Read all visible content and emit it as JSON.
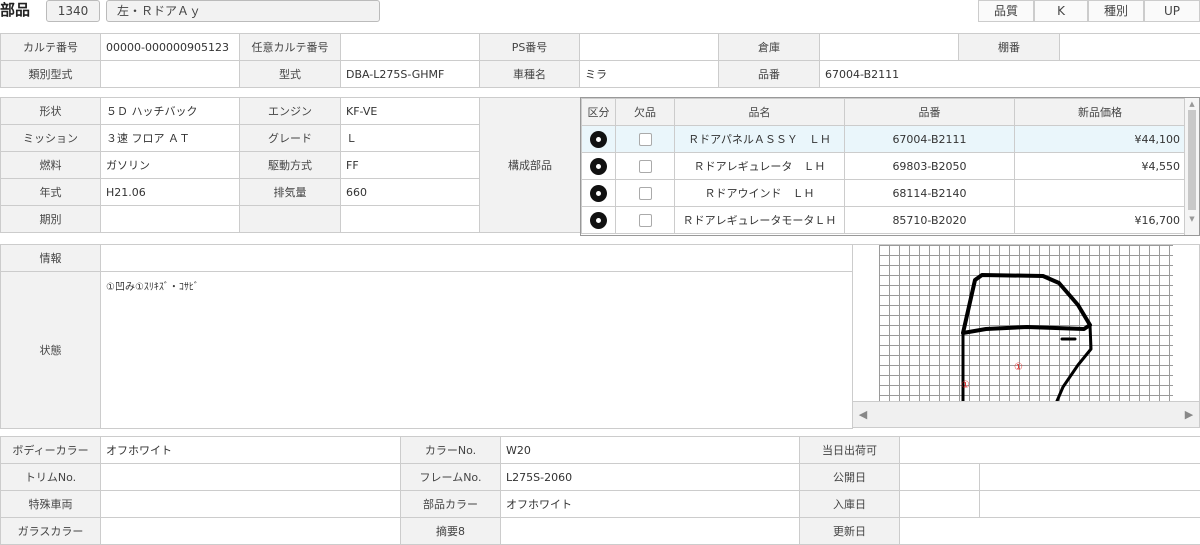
{
  "header": {
    "title": "部品",
    "code": "1340",
    "name": "左・ＲドアＡｙ",
    "quality_label": "品質",
    "quality_value": "K",
    "kind_label": "種別",
    "kind_value": "UP"
  },
  "info_rows": {
    "r1": {
      "karte_label": "カルテ番号",
      "karte_value": "00000-000000905123",
      "any_karte_label": "任意カルテ番号",
      "any_karte_value": "",
      "ps_label": "PS番号",
      "ps_value": "",
      "warehouse_label": "倉庫",
      "warehouse_value": "",
      "shelf_label": "棚番",
      "shelf_value": ""
    },
    "r2": {
      "class_type_label": "類別型式",
      "class_type_value": "",
      "model_label": "型式",
      "model_value": "DBA-L275S-GHMF",
      "car_label": "車種名",
      "car_value": "ミラ",
      "partno_label": "品番",
      "partno_value": "67004-B2111"
    }
  },
  "spec": {
    "rows": [
      {
        "l1": "形状",
        "v1": "５Ｄ ハッチバック",
        "l2": "エンジン",
        "v2": "KF-VE"
      },
      {
        "l1": "ミッション",
        "v1": "３速 フロア ＡＴ",
        "l2": "グレード",
        "v2": "Ｌ"
      },
      {
        "l1": "燃料",
        "v1": "ガソリン",
        "l2": "駆動方式",
        "v2": "FF"
      },
      {
        "l1": "年式",
        "v1": "H21.06",
        "l2": "排気量",
        "v2": "660"
      },
      {
        "l1": "期別",
        "v1": "",
        "l2": "",
        "v2": ""
      }
    ],
    "component_label": "構成部品"
  },
  "parts": {
    "headers": {
      "kubun": "区分",
      "missing": "欠品",
      "name": "品名",
      "number": "品番",
      "price": "新品価格"
    },
    "rows": [
      {
        "name": "ＲドアパネルＡＳＳＹ　ＬＨ",
        "number": "67004-B2111",
        "price": "¥44,100"
      },
      {
        "name": "Ｒドアレギュレータ　ＬＨ",
        "number": "69803-B2050",
        "price": "¥4,550"
      },
      {
        "name": "Ｒドアウインド　ＬＨ",
        "number": "68114-B2140",
        "price": ""
      },
      {
        "name": "ＲドアレギュレータモータＬＨ",
        "number": "85710-B2020",
        "price": "¥16,700"
      }
    ]
  },
  "notes": {
    "info_label": "情報",
    "info_value": "",
    "state_label": "状態",
    "state_value": "①凹み①ｽﾘｷｽﾞ・ｺｻﾋﾞ"
  },
  "diagram": {
    "marker_1": "①",
    "marker_2": "①",
    "marker_color": "#e02020"
  },
  "bottom": {
    "rows": [
      {
        "l1": "ボディーカラー",
        "v1": "オフホワイト",
        "l2": "カラーNo.",
        "v2": "W20",
        "l3": "当日出荷可",
        "v3": ""
      },
      {
        "l1": "トリムNo.",
        "v1": "",
        "l2": "フレームNo.",
        "v2": "L275S-2060",
        "l3": "公開日",
        "v3": ""
      },
      {
        "l1": "特殊車両",
        "v1": "",
        "l2": "部品カラー",
        "v2": "オフホワイト",
        "l3": "入庫日",
        "v3": ""
      },
      {
        "l1": "ガラスカラー",
        "v1": "",
        "l2": "摘要8",
        "v2": "",
        "l3": "更新日",
        "v3": ""
      }
    ]
  }
}
